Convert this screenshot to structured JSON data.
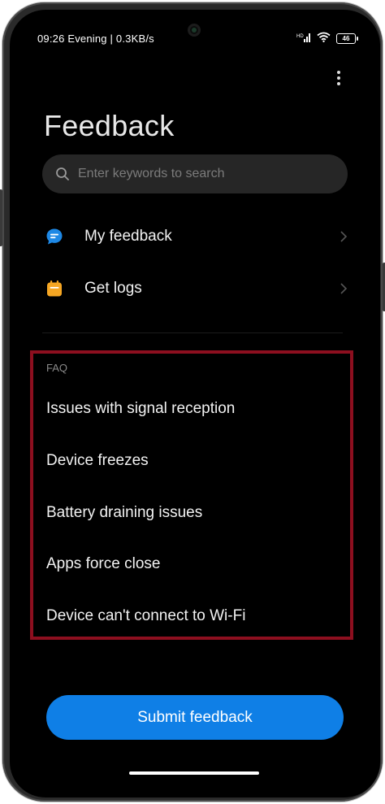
{
  "status_bar": {
    "text": "09:26 Evening | 0.3KB/s",
    "battery": "46"
  },
  "header": {
    "title": "Feedback"
  },
  "search": {
    "placeholder": "Enter keywords to search"
  },
  "menu": [
    {
      "label": "My feedback",
      "icon": "chat-bubble-icon",
      "icon_color": "#1e88e5"
    },
    {
      "label": "Get logs",
      "icon": "calendar-icon",
      "icon_color": "#f5a623"
    }
  ],
  "faq": {
    "heading": "FAQ",
    "items": [
      "Issues with signal reception",
      "Device freezes",
      "Battery draining issues",
      "Apps force close",
      "Device can't connect to Wi-Fi"
    ]
  },
  "submit_label": "Submit feedback",
  "colors": {
    "accent": "#0f7fe6",
    "highlight_box": "#8d0f1f",
    "background": "#000000"
  }
}
